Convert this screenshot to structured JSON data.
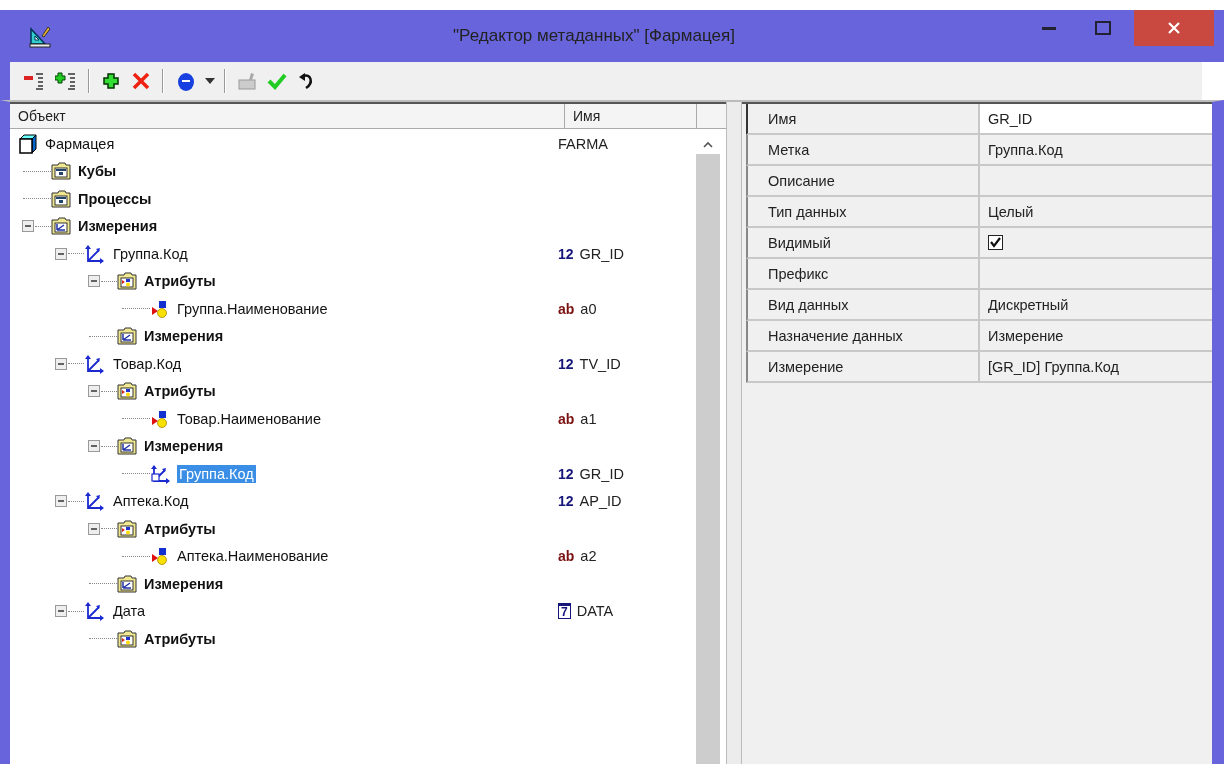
{
  "window": {
    "title": "\"Редактор метаданных\" [Фармацея]"
  },
  "tree": {
    "columns": [
      "Объект",
      "Имя"
    ],
    "nodes": [
      {
        "label": "Фармацея",
        "kind": "cube",
        "name": "FARMA",
        "bold": false,
        "selected": false,
        "children": [
          {
            "label": "Кубы",
            "kind": "folder",
            "bold": true,
            "selected": false
          },
          {
            "label": "Процессы",
            "kind": "folder",
            "bold": true,
            "selected": false
          },
          {
            "label": "Измерения",
            "kind": "dimfolder",
            "bold": true,
            "expanded": true,
            "selected": false,
            "children": [
              {
                "label": "Группа.Код",
                "kind": "dimension",
                "type": {
                  "kind": "int",
                  "mark": "12"
                },
                "name": "GR_ID",
                "bold": false,
                "expanded": true,
                "selected": false,
                "children": [
                  {
                    "label": "Атрибуты",
                    "kind": "attrfolder",
                    "bold": true,
                    "expanded": true,
                    "selected": false,
                    "children": [
                      {
                        "label": "Группа.Наименование",
                        "kind": "attribute",
                        "type": {
                          "kind": "str",
                          "mark": "ab"
                        },
                        "name": "a0",
                        "bold": false,
                        "selected": false
                      }
                    ]
                  },
                  {
                    "label": "Измерения",
                    "kind": "dimfolder",
                    "bold": true,
                    "selected": false
                  }
                ]
              },
              {
                "label": "Товар.Код",
                "kind": "dimension",
                "type": {
                  "kind": "int",
                  "mark": "12"
                },
                "name": "TV_ID",
                "bold": false,
                "expanded": true,
                "selected": false,
                "children": [
                  {
                    "label": "Атрибуты",
                    "kind": "attrfolder",
                    "bold": true,
                    "expanded": true,
                    "selected": false,
                    "children": [
                      {
                        "label": "Товар.Наименование",
                        "kind": "attribute",
                        "type": {
                          "kind": "str",
                          "mark": "ab"
                        },
                        "name": "a1",
                        "bold": false,
                        "selected": false
                      }
                    ]
                  },
                  {
                    "label": "Измерения",
                    "kind": "dimfolder",
                    "bold": true,
                    "expanded": true,
                    "selected": false,
                    "children": [
                      {
                        "label": "Группа.Код",
                        "kind": "dimlink",
                        "type": {
                          "kind": "int",
                          "mark": "12"
                        },
                        "name": "GR_ID",
                        "bold": false,
                        "selected": true
                      }
                    ]
                  }
                ]
              },
              {
                "label": "Аптека.Код",
                "kind": "dimension",
                "type": {
                  "kind": "int",
                  "mark": "12"
                },
                "name": "AP_ID",
                "bold": false,
                "expanded": true,
                "selected": false,
                "children": [
                  {
                    "label": "Атрибуты",
                    "kind": "attrfolder",
                    "bold": true,
                    "expanded": true,
                    "selected": false,
                    "children": [
                      {
                        "label": "Аптека.Наименование",
                        "kind": "attribute",
                        "type": {
                          "kind": "str",
                          "mark": "ab"
                        },
                        "name": "a2",
                        "bold": false,
                        "selected": false
                      }
                    ]
                  },
                  {
                    "label": "Измерения",
                    "kind": "dimfolder",
                    "bold": true,
                    "selected": false
                  }
                ]
              },
              {
                "label": "Дата",
                "kind": "dimension",
                "type": {
                  "kind": "date",
                  "mark": "7"
                },
                "name": "DATA",
                "bold": false,
                "expanded": true,
                "selected": false,
                "children": [
                  {
                    "label": "Атрибуты",
                    "kind": "attrfolder",
                    "bold": true,
                    "selected": false
                  }
                ]
              }
            ]
          }
        ]
      }
    ]
  },
  "properties": [
    {
      "name": "Имя",
      "kind": "text",
      "value": "GR_ID",
      "selected": true
    },
    {
      "name": "Метка",
      "kind": "text",
      "value": "Группа.Код",
      "selected": false
    },
    {
      "name": "Описание",
      "kind": "text",
      "selected": false
    },
    {
      "name": "Тип данных",
      "kind": "text",
      "value": "Целый",
      "selected": false
    },
    {
      "name": "Видимый",
      "kind": "checkbox",
      "checked": true,
      "selected": false
    },
    {
      "name": "Префикс",
      "kind": "text",
      "selected": false
    },
    {
      "name": "Вид данных",
      "kind": "text",
      "value": "Дискретный",
      "selected": false
    },
    {
      "name": "Назначение данных",
      "kind": "text",
      "value": "Измерение",
      "selected": false
    },
    {
      "name": "Измерение",
      "kind": "text",
      "value": "[GR_ID] Группа.Код",
      "selected": false
    }
  ]
}
